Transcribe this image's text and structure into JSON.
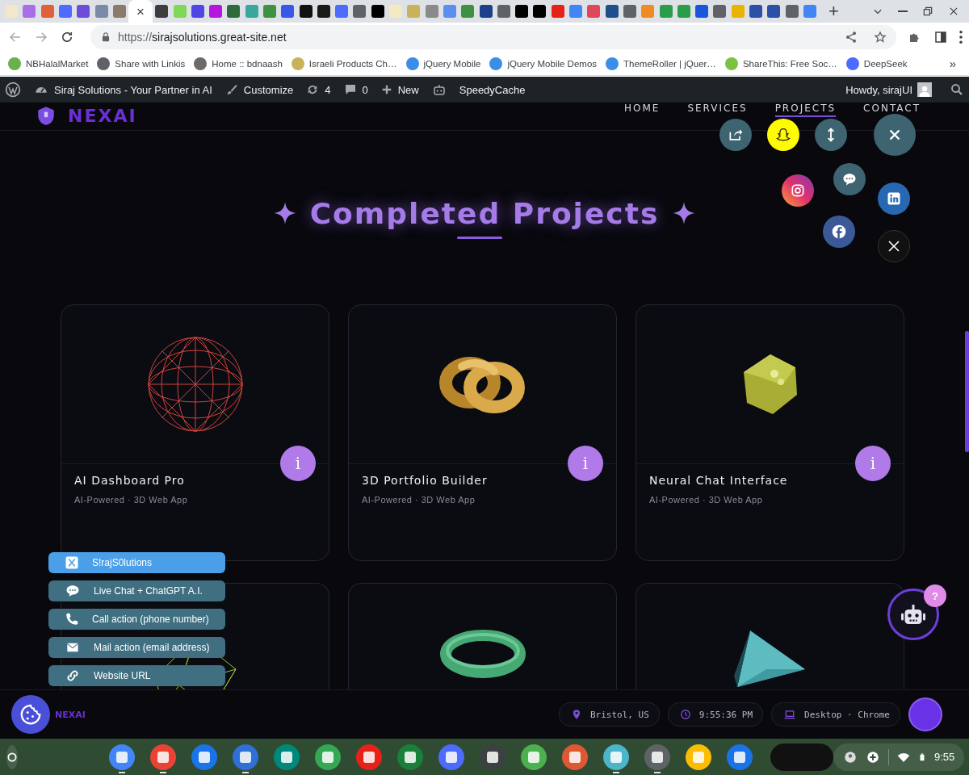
{
  "browser": {
    "tabs": [
      {
        "color": "#f4e6c8",
        "selected": false
      },
      {
        "color": "#a86ee8",
        "selected": false
      },
      {
        "color": "#e0603a",
        "selected": false
      },
      {
        "color": "#4d6bfe",
        "selected": false
      },
      {
        "color": "#6d4cd8",
        "selected": false
      },
      {
        "color": "#7a8aa8",
        "selected": false
      },
      {
        "color": "#8a7a6a",
        "selected": false
      },
      {
        "selected": true
      },
      {
        "color": "#3c3c3c",
        "selected": false
      },
      {
        "color": "#7ed957",
        "selected": false
      },
      {
        "color": "#4f46e5",
        "selected": false
      },
      {
        "color": "#b517e0",
        "selected": false
      },
      {
        "color": "#2e6b3a",
        "selected": false
      },
      {
        "color": "#38a89d",
        "selected": false
      },
      {
        "color": "#3f9142",
        "selected": false
      },
      {
        "color": "#3858e9",
        "selected": false
      },
      {
        "color": "#111111",
        "selected": false
      },
      {
        "color": "#1a1a1a",
        "selected": false
      },
      {
        "color": "#4d6bfe",
        "selected": false
      },
      {
        "color": "#5f6368",
        "selected": false
      },
      {
        "color": "#000000",
        "selected": false
      },
      {
        "color": "#f5e9c0",
        "selected": false
      },
      {
        "color": "#c9b35a",
        "selected": false
      },
      {
        "color": "#8a8a8a",
        "selected": false
      },
      {
        "color": "#5a8ff0",
        "selected": false
      },
      {
        "color": "#3f9142",
        "selected": false
      },
      {
        "color": "#1d3f8a",
        "selected": false
      },
      {
        "color": "#5f6368",
        "selected": false
      },
      {
        "color": "#000000",
        "selected": false
      },
      {
        "color": "#000000",
        "selected": false
      },
      {
        "color": "#e62117",
        "selected": false
      },
      {
        "color": "#4285f4",
        "selected": false
      },
      {
        "color": "#e0475a",
        "selected": false
      },
      {
        "color": "#1f4e8c",
        "selected": false
      },
      {
        "color": "#5f6368",
        "selected": false
      },
      {
        "color": "#f08a24",
        "selected": false
      },
      {
        "color": "#2a9d4a",
        "selected": false
      },
      {
        "color": "#2a9d4a",
        "selected": false
      },
      {
        "color": "#1a56db",
        "selected": false
      },
      {
        "color": "#5f6368",
        "selected": false
      },
      {
        "color": "#e8b400",
        "selected": false
      },
      {
        "color": "#2c4fa8",
        "selected": false
      },
      {
        "color": "#2c4fa8",
        "selected": false
      },
      {
        "color": "#5f6368",
        "selected": false
      },
      {
        "color": "#4285f4",
        "selected": false
      }
    ],
    "close_glyph": "×",
    "new_tab": "+",
    "url_scheme": "https://",
    "url_host": "sirajsolutions.great-site.net",
    "bookmarks": [
      {
        "label": "NBHalalMarket",
        "color": "#6ab04c"
      },
      {
        "label": "Share with Linkis",
        "color": "#5f6368"
      },
      {
        "label": "Home :: bdnaash",
        "color": "#6b6b6b"
      },
      {
        "label": "Israeli Products Ch…",
        "color": "#c9b35a"
      },
      {
        "label": "jQuery Mobile",
        "color": "#3b8ee8"
      },
      {
        "label": "jQuery Mobile Demos",
        "color": "#3b8ee8"
      },
      {
        "label": "ThemeRoller | jQuer…",
        "color": "#3b8ee8"
      },
      {
        "label": "ShareThis: Free Soc…",
        "color": "#7cc242"
      },
      {
        "label": "DeepSeek",
        "color": "#4d6bfe"
      }
    ],
    "more_bookmarks": "»"
  },
  "admin_bar": {
    "site_name": "Siraj Solutions - Your Partner in AI",
    "customize": "Customize",
    "updates": "4",
    "comments": "0",
    "new": "New",
    "cache": "SpeedyCache",
    "greeting": "Howdy, sirajUI"
  },
  "site": {
    "logo": "NEXAI",
    "nav": [
      {
        "label": "HOME",
        "selected": false
      },
      {
        "label": "SERVICES",
        "selected": false
      },
      {
        "label": "PROJECTS",
        "selected": true
      },
      {
        "label": "CONTACT",
        "selected": false
      }
    ],
    "title": "Completed Projects",
    "projects": [
      {
        "kind": "wire_sphere",
        "title": "AI Dashboard Pro",
        "subtitle": "AI-Powered · 3D Web App",
        "info": "i"
      },
      {
        "kind": "knot",
        "title": "3D Portfolio Builder",
        "subtitle": "AI-Powered · 3D Web App",
        "info": "i"
      },
      {
        "kind": "polyhedron",
        "title": "Neural Chat Interface",
        "subtitle": "AI-Powered · 3D Web App",
        "info": "i"
      },
      {
        "kind": "wire_shape"
      },
      {
        "kind": "torus"
      },
      {
        "kind": "pyramid"
      }
    ]
  },
  "share_menu": [
    {
      "kind": "share"
    },
    {
      "kind": "snapchat"
    },
    {
      "kind": "scroll"
    },
    {
      "kind": "close"
    },
    {
      "kind": "instagram"
    },
    {
      "kind": "chat"
    },
    {
      "kind": "linkedin"
    },
    {
      "kind": "facebook"
    },
    {
      "kind": "x"
    }
  ],
  "contact_buttons": [
    {
      "kind": "x",
      "label": "S!rajS0lutions",
      "selected": true
    },
    {
      "kind": "chat",
      "label": "Live Chat + ChatGPT A.I.",
      "selected": false
    },
    {
      "kind": "phone",
      "label": "Call action (phone number)",
      "selected": false
    },
    {
      "kind": "mail",
      "label": "Mail action (email address)",
      "selected": false
    },
    {
      "kind": "link",
      "label": "Website URL",
      "selected": false
    }
  ],
  "footer": {
    "logo": "NEXAI",
    "location": "Bristol, US",
    "time": "9:55:36 PM",
    "device": "Desktop · Chrome"
  },
  "chatbot": {
    "badge": "?"
  },
  "shelf": {
    "apps": [
      {
        "color": "#4285f4",
        "running": true
      },
      {
        "color": "#ea4335",
        "running": true
      },
      {
        "color": "#1a73e8",
        "running": false
      },
      {
        "color": "#2f6fd6",
        "running": true
      },
      {
        "color": "#00897b",
        "running": false
      },
      {
        "color": "#34a853",
        "running": false
      },
      {
        "color": "#e62117",
        "running": false
      },
      {
        "color": "#188038",
        "running": false
      },
      {
        "color": "#4d6bfe",
        "running": false
      },
      {
        "color": "#3c4043",
        "running": false
      },
      {
        "color": "#4caf50",
        "running": false
      },
      {
        "color": "#de5833",
        "running": false
      },
      {
        "color": "#4bb5c9",
        "running": true
      },
      {
        "color": "#5f6368",
        "running": true
      },
      {
        "color": "#fbbc04",
        "running": false
      },
      {
        "color": "#1a73e8",
        "running": false
      }
    ],
    "time": "9:55"
  }
}
